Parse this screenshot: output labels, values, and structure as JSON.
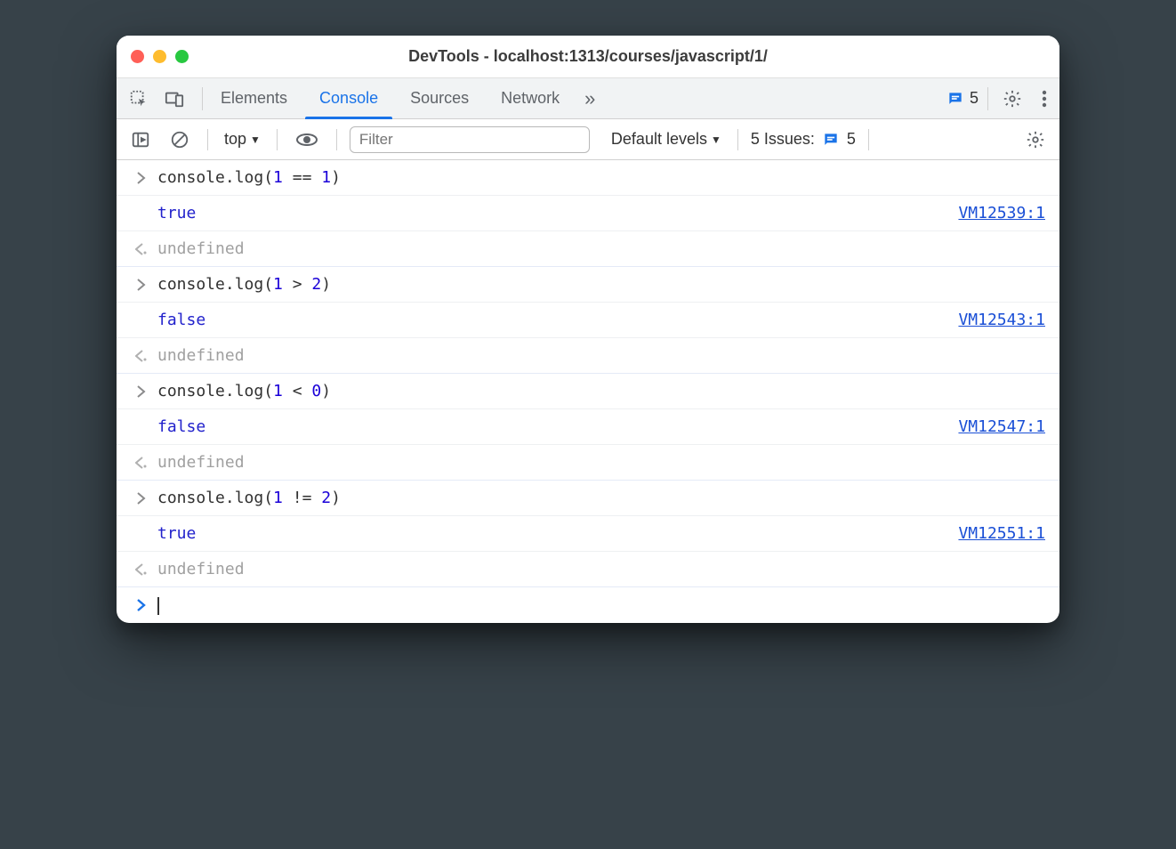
{
  "window": {
    "title": "DevTools - localhost:1313/courses/javascript/1/"
  },
  "tabs": {
    "items": [
      "Elements",
      "Console",
      "Sources",
      "Network"
    ],
    "active_index": 1,
    "messages_count": "5"
  },
  "toolbar": {
    "context": "top",
    "filter_placeholder": "Filter",
    "levels": "Default levels",
    "issues_label": "5 Issues:",
    "issues_count": "5"
  },
  "console": {
    "entries": [
      {
        "type": "input",
        "code_prefix": "console.log(",
        "num1": "1",
        "op": " == ",
        "num2": "1",
        "code_suffix": ")"
      },
      {
        "type": "result",
        "value": "true",
        "src": "VM12539:1"
      },
      {
        "type": "return",
        "value": "undefined"
      },
      {
        "type": "input",
        "code_prefix": "console.log(",
        "num1": "1",
        "op": " > ",
        "num2": "2",
        "code_suffix": ")"
      },
      {
        "type": "result",
        "value": "false",
        "src": "VM12543:1"
      },
      {
        "type": "return",
        "value": "undefined"
      },
      {
        "type": "input",
        "code_prefix": "console.log(",
        "num1": "1",
        "op": " < ",
        "num2": "0",
        "code_suffix": ")"
      },
      {
        "type": "result",
        "value": "false",
        "src": "VM12547:1"
      },
      {
        "type": "return",
        "value": "undefined"
      },
      {
        "type": "input",
        "code_prefix": "console.log(",
        "num1": "1",
        "op": " != ",
        "num2": "2",
        "code_suffix": ")"
      },
      {
        "type": "result",
        "value": "true",
        "src": "VM12551:1"
      },
      {
        "type": "return",
        "value": "undefined"
      }
    ]
  }
}
